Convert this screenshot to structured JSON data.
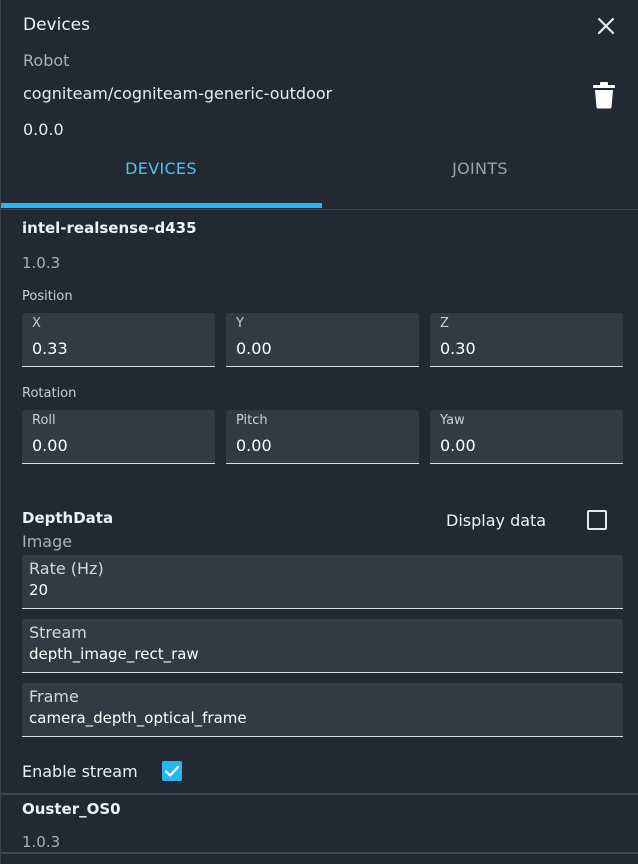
{
  "header": {
    "title": "Devices",
    "robot_label": "Robot",
    "robot_name": "cogniteam/cogniteam-generic-outdoor",
    "version": "0.0.0",
    "close_icon": "close-icon",
    "delete_icon": "trash-icon"
  },
  "tabs": [
    {
      "label": "DEVICES",
      "active": true
    },
    {
      "label": "JOINTS",
      "active": false
    }
  ],
  "device": {
    "name": "intel-realsense-d435",
    "version": "1.0.3",
    "position_label": "Position",
    "position": [
      {
        "label": "X",
        "value": "0.33"
      },
      {
        "label": "Y",
        "value": "0.00"
      },
      {
        "label": "Z",
        "value": "0.30"
      }
    ],
    "rotation_label": "Rotation",
    "rotation": [
      {
        "label": "Roll",
        "value": "0.00"
      },
      {
        "label": "Pitch",
        "value": "0.00"
      },
      {
        "label": "Yaw",
        "value": "0.00"
      }
    ]
  },
  "depth": {
    "title": "DepthData",
    "type": "Image",
    "display_label": "Display data",
    "display_checked": false,
    "rate": {
      "label": "Rate (Hz)",
      "value": "20"
    },
    "stream": {
      "label": "Stream",
      "value": "depth_image_rect_raw"
    },
    "frame": {
      "label": "Frame",
      "value": "camera_depth_optical_frame"
    },
    "enable_label": "Enable stream",
    "enable_checked": true
  },
  "next_device": {
    "name": "Ouster_OS0",
    "version": "1.0.3"
  },
  "colors": {
    "background": "#222932",
    "field": "#323a44",
    "accent": "#29b6f0"
  }
}
